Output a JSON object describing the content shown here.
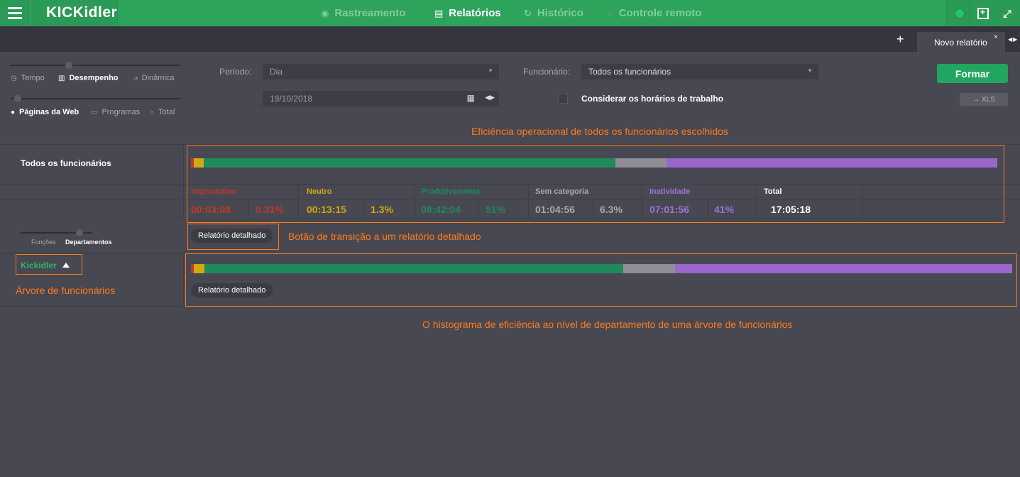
{
  "app": {
    "logo": "KICKidler",
    "nav": [
      {
        "label": "Rastreamento",
        "icon": "eye-icon"
      },
      {
        "label": "Relatórios",
        "icon": "document-icon",
        "active": true
      },
      {
        "label": "Histórico",
        "icon": "history-icon"
      },
      {
        "label": "Controle remoto",
        "icon": "remote-icon"
      }
    ]
  },
  "tabs": {
    "add": "+",
    "active": "Novo relatório",
    "close": "×",
    "arrows": "◀▶"
  },
  "left": {
    "mode_options": [
      "Tempo",
      "Desempenho",
      "Dinâmica"
    ],
    "mode_selected": "Desempenho",
    "source_options": [
      "Páginas da Web",
      "Programas",
      "Total"
    ],
    "source_selected": "Páginas da Web",
    "group_options": [
      "Funções",
      "Departamentos"
    ],
    "group_selected": "Departamentos"
  },
  "filters": {
    "period_label": "Período:",
    "period_value": "Dia",
    "date_value": "19/10/2018",
    "employee_label": "Funcionário:",
    "employee_value": "Todos os funcionários",
    "work_hours_label": "Considerar os horários de trabalho",
    "form_button": "Formar",
    "xls_button": "→ XLS"
  },
  "annotations": {
    "top": "Eficiência operacional de todos os funcionários escolhidos",
    "detail_button": "Botão de transição a um relatório detalhado",
    "tree": "Árvore de funcionários",
    "histogram": "O histograma de eficiência ao nível de departamento de uma árvore de funcionários"
  },
  "summary": {
    "title": "Todos os funcionários",
    "categories": [
      {
        "label": "Improdutivo",
        "time": "00:03:08",
        "pct": "0.31%",
        "fraction": 0.0031,
        "color": "#c0392b"
      },
      {
        "label": "Neutro",
        "time": "00:13:15",
        "pct": "1.3%",
        "fraction": 0.013,
        "color": "#d4a810"
      },
      {
        "label": "Produtivamente",
        "time": "08:42:04",
        "pct": "51%",
        "fraction": 0.51,
        "color": "#1f8a5a"
      },
      {
        "label": "Sem categoria",
        "time": "01:04:56",
        "pct": "6.3%",
        "fraction": 0.063,
        "color": "#8e8e94"
      },
      {
        "label": "Inatividade",
        "time": "07:01:56",
        "pct": "41%",
        "fraction": 0.41,
        "color": "#9966cc"
      }
    ],
    "total_label": "Total",
    "total_value": "17:05:18",
    "detail_button": "Relatório detalhado"
  },
  "tree": {
    "root": "Kickidler",
    "detail_button": "Relatório detalhado"
  },
  "colors": {
    "brand": "#2ea35c",
    "improdutivo_text": "#c0392b",
    "neutro_text": "#d4a810",
    "produtivo_text": "#1f8a5a",
    "sem_text": "#a8a8ae",
    "inativ_text": "#a070d8",
    "annotation": "#ff7a1c"
  }
}
